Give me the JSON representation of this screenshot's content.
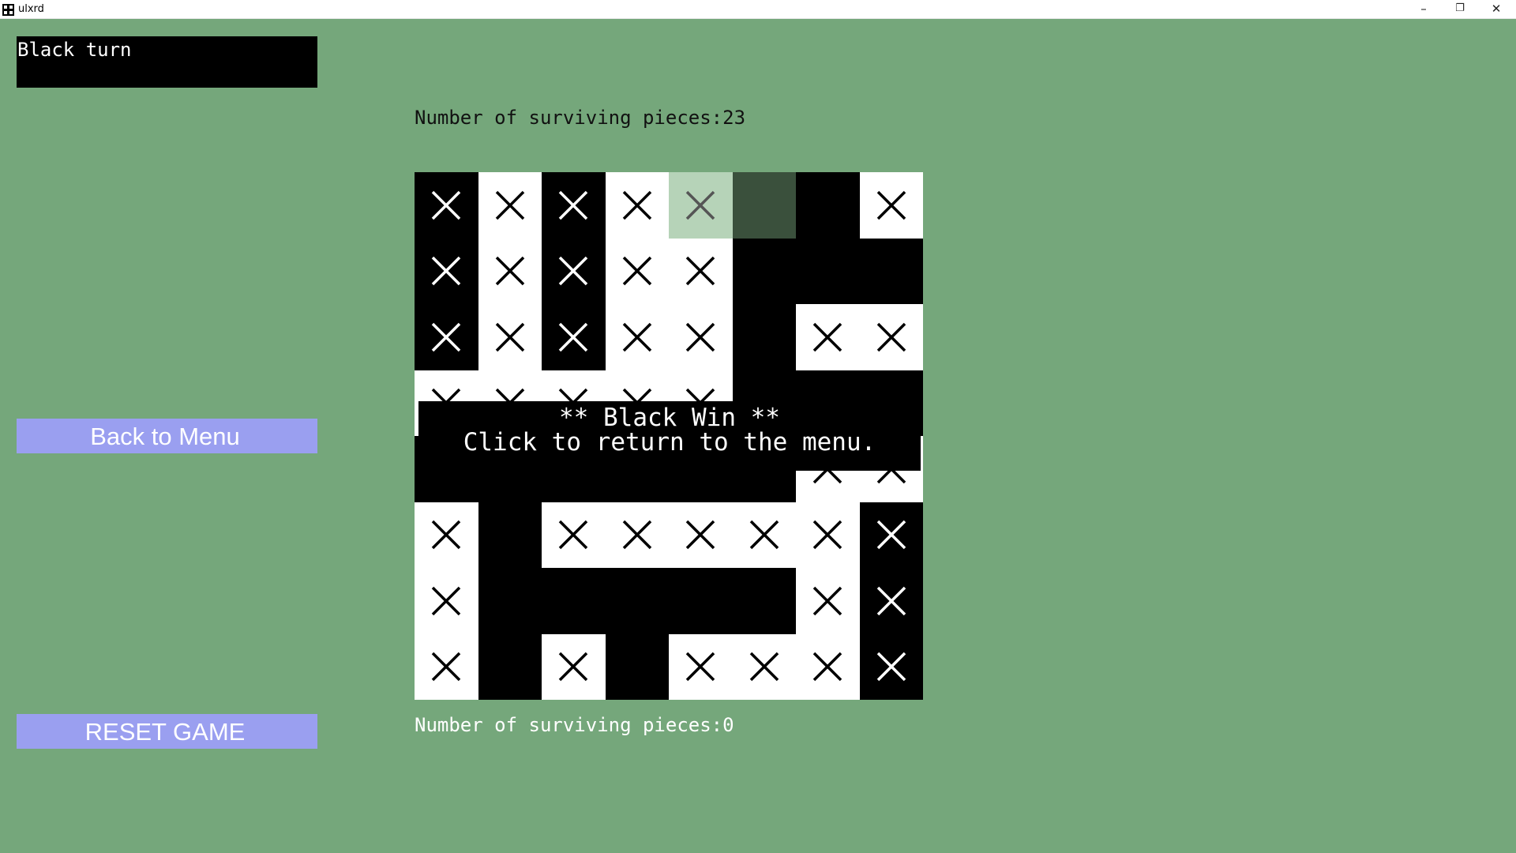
{
  "window": {
    "title": "ulxrd"
  },
  "status": {
    "turn": "Black turn"
  },
  "scores": {
    "top": "Number of surviving pieces:23",
    "bottom": "Number of surviving pieces:0"
  },
  "buttons": {
    "menu": "Back to Menu",
    "reset": "RESET GAME"
  },
  "overlay": {
    "line1": "** Black Win **",
    "line2": "Click to return to the menu."
  },
  "board": {
    "size": 8,
    "cell_bg": [
      [
        "B",
        "W",
        "B",
        "W",
        "L",
        "D",
        "B",
        "W"
      ],
      [
        "B",
        "W",
        "B",
        "W",
        "W",
        "B",
        "B",
        "B"
      ],
      [
        "B",
        "W",
        "B",
        "W",
        "W",
        "B",
        "W",
        "W"
      ],
      [
        "W",
        "W",
        "W",
        "W",
        "W",
        "B",
        "B",
        "B"
      ],
      [
        "B",
        "B",
        "B",
        "B",
        "B",
        "B",
        "W",
        "W"
      ],
      [
        "W",
        "B",
        "W",
        "W",
        "W",
        "W",
        "W",
        "B"
      ],
      [
        "W",
        "B",
        "B",
        "B",
        "B",
        "B",
        "W",
        "B"
      ],
      [
        "W",
        "B",
        "W",
        "B",
        "W",
        "W",
        "W",
        "B"
      ]
    ],
    "pieces": [
      [
        1,
        1,
        1,
        1,
        1,
        0,
        0,
        1
      ],
      [
        1,
        1,
        1,
        1,
        1,
        0,
        0,
        0
      ],
      [
        1,
        1,
        1,
        1,
        1,
        0,
        1,
        1
      ],
      [
        1,
        1,
        1,
        1,
        1,
        0,
        0,
        0
      ],
      [
        0,
        0,
        0,
        0,
        0,
        0,
        1,
        1
      ],
      [
        1,
        0,
        1,
        1,
        1,
        1,
        1,
        1
      ],
      [
        1,
        0,
        0,
        0,
        0,
        0,
        1,
        1
      ],
      [
        1,
        0,
        1,
        0,
        1,
        1,
        1,
        1
      ]
    ]
  },
  "colors": {
    "background": "#75a77b",
    "button": "#9a9ff0",
    "selected_light": "#b6d3b8",
    "selected_dark": "#3a503c"
  },
  "icons": {
    "piece": "x-mark-icon",
    "close": "close-icon",
    "minimize": "minimize-icon",
    "restore": "restore-icon"
  }
}
